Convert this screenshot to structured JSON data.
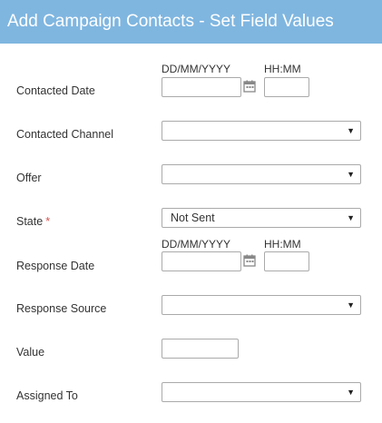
{
  "title": "Add Campaign Contacts - Set Field Values",
  "fields": {
    "contacted_date": {
      "label": "Contacted Date",
      "date_hint": "DD/MM/YYYY",
      "time_hint": "HH:MM",
      "date_value": "",
      "time_value": ""
    },
    "contacted_channel": {
      "label": "Contacted Channel",
      "value": ""
    },
    "offer": {
      "label": "Offer",
      "value": ""
    },
    "state": {
      "label": "State",
      "required_marker": "*",
      "value": "Not Sent"
    },
    "response_date": {
      "label": "Response Date",
      "date_hint": "DD/MM/YYYY",
      "time_hint": "HH:MM",
      "date_value": "",
      "time_value": ""
    },
    "response_source": {
      "label": "Response Source",
      "value": ""
    },
    "value": {
      "label": "Value",
      "value": ""
    },
    "assigned_to": {
      "label": "Assigned To",
      "value": ""
    }
  },
  "icons": {
    "calendar": "calendar-icon",
    "dropdown": "chevron-down-icon"
  },
  "colors": {
    "header_bg": "#7fb6e0",
    "header_text": "#ffffff",
    "required": "#d9534f"
  }
}
